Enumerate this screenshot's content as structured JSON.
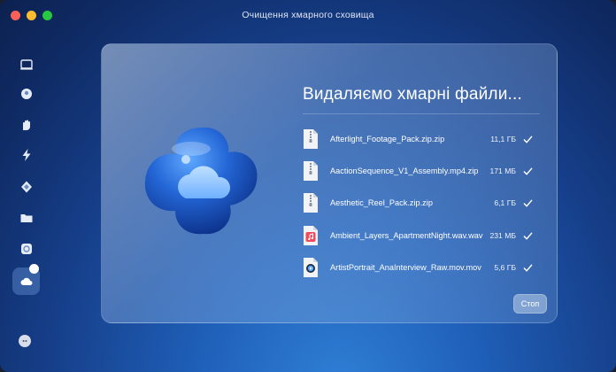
{
  "window": {
    "title": "Очищення хмарного сховища"
  },
  "sidebar": {
    "items": [
      {
        "icon": "smart-scan-icon"
      },
      {
        "icon": "cleanup-icon"
      },
      {
        "icon": "protection-icon"
      },
      {
        "icon": "performance-icon"
      },
      {
        "icon": "applications-icon"
      },
      {
        "icon": "files-icon"
      },
      {
        "icon": "space-lens-icon"
      },
      {
        "icon": "cloud-cleanup-icon",
        "active": true
      }
    ]
  },
  "main": {
    "heading": "Видаляємо хмарні файли...",
    "files": [
      {
        "name": "Afterlight_Footage_Pack.zip.zip",
        "size": "11,1 ГБ",
        "type": "zip"
      },
      {
        "name": "AactionSequence_V1_Assembly.mp4.zip",
        "size": "171 МБ",
        "type": "zip"
      },
      {
        "name": "Aesthetic_Reel_Pack.zip.zip",
        "size": "6,1 ГБ",
        "type": "zip"
      },
      {
        "name": "Ambient_Layers_ApartmentNight.wav.wav",
        "size": "231 МБ",
        "type": "audio"
      },
      {
        "name": "ArtistPortrait_AnaInterview_Raw.mov.mov",
        "size": "5,6 ГБ",
        "type": "video"
      }
    ],
    "stop_label": "Стоп"
  },
  "colors": {
    "accent": "#2f7fd6",
    "background_dark": "#0f2a63",
    "check": "#ffffff"
  }
}
